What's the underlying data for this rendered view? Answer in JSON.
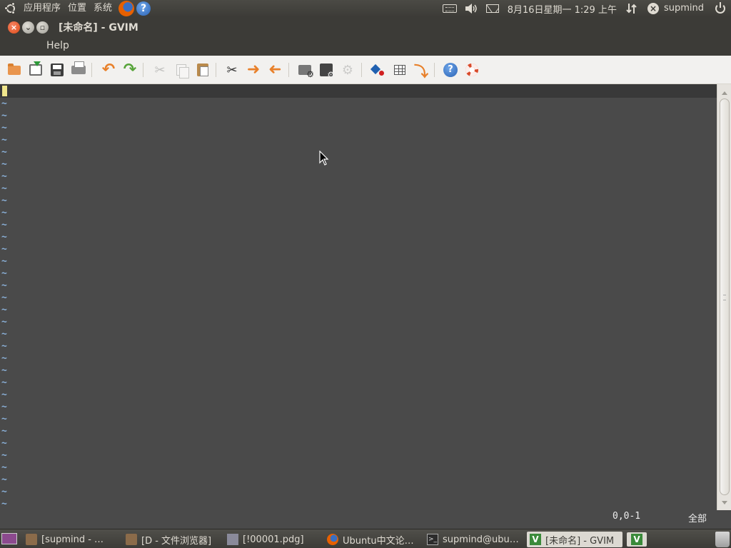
{
  "top_panel": {
    "menus": [
      "应用程序",
      "位置",
      "系统"
    ],
    "clock": "8月16日星期一  1:29 上午",
    "user": "supmind",
    "icons": [
      "ubuntu-logo-icon",
      "firefox-icon",
      "help-icon",
      "keyboard-icon",
      "volume-icon",
      "mail-icon",
      "network-icon",
      "user-status-icon",
      "power-icon"
    ]
  },
  "window": {
    "title": "[未命名] - GVIM"
  },
  "menubar": {
    "items": [
      "Help"
    ]
  },
  "toolbar": {
    "buttons": [
      "open",
      "save-download",
      "save",
      "print",
      "undo",
      "redo",
      "cut",
      "copy",
      "paste",
      "find-replace",
      "find-next",
      "find-prev",
      "load-session",
      "save-session",
      "run-script",
      "make",
      "build-tags",
      "jump-to-tag",
      "help",
      "find-help"
    ]
  },
  "editor": {
    "tilde": "~",
    "tilde_lines": 34,
    "colors": {
      "background": "#4a4a4a",
      "cursor": "#f0e68c",
      "tilde": "#8ab0d8"
    }
  },
  "statusline": {
    "ruler": "0,0-1",
    "percent": "全部"
  },
  "taskbar": {
    "tasks": [
      {
        "label": "[supmind - …",
        "icon": "folder-icon"
      },
      {
        "label": "[D - 文件浏览器]",
        "icon": "folder-icon"
      },
      {
        "label": "[!00001.pdg]",
        "icon": "image-icon"
      },
      {
        "label": "Ubuntu中文论…",
        "icon": "firefox-icon"
      },
      {
        "label": "supmind@ubu…",
        "icon": "terminal-icon"
      },
      {
        "label": "[未命名] - GVIM",
        "icon": "gvim-icon"
      }
    ]
  }
}
